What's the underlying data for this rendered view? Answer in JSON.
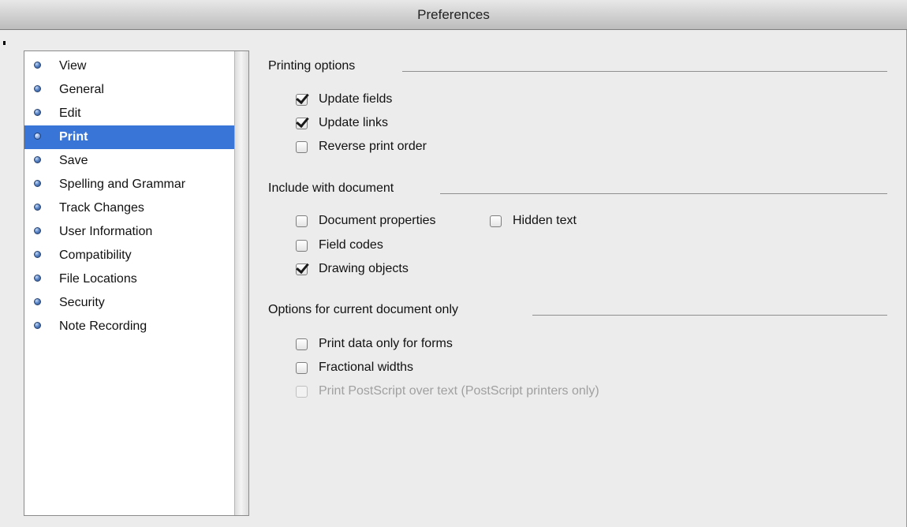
{
  "window": {
    "title": "Preferences"
  },
  "sidebar": {
    "items": [
      {
        "label": "View"
      },
      {
        "label": "General"
      },
      {
        "label": "Edit"
      },
      {
        "label": "Print",
        "selected": true
      },
      {
        "label": "Save"
      },
      {
        "label": "Spelling and Grammar"
      },
      {
        "label": "Track Changes"
      },
      {
        "label": "User Information"
      },
      {
        "label": "Compatibility"
      },
      {
        "label": "File Locations"
      },
      {
        "label": "Security"
      },
      {
        "label": "Note Recording"
      }
    ]
  },
  "printing_options": {
    "header": "Printing options",
    "update_fields": {
      "label": "Update fields",
      "checked": true
    },
    "update_links": {
      "label": "Update links",
      "checked": true
    },
    "reverse_print_order": {
      "label": "Reverse print order",
      "checked": false
    }
  },
  "include_with_document": {
    "header": "Include with document",
    "document_properties": {
      "label": "Document properties",
      "checked": false
    },
    "hidden_text": {
      "label": "Hidden text",
      "checked": false
    },
    "field_codes": {
      "label": "Field codes",
      "checked": false
    },
    "drawing_objects": {
      "label": "Drawing objects",
      "checked": true
    }
  },
  "current_document_options": {
    "header": "Options for current document only",
    "print_data_only_for_forms": {
      "label": "Print data only for forms",
      "checked": false
    },
    "fractional_widths": {
      "label": "Fractional widths",
      "checked": false
    },
    "print_postscript_over_text": {
      "label": "Print PostScript over text (PostScript printers only)",
      "checked": false,
      "enabled": false
    }
  },
  "colors": {
    "selection": "#3875d7",
    "window_background": "#ececec"
  }
}
